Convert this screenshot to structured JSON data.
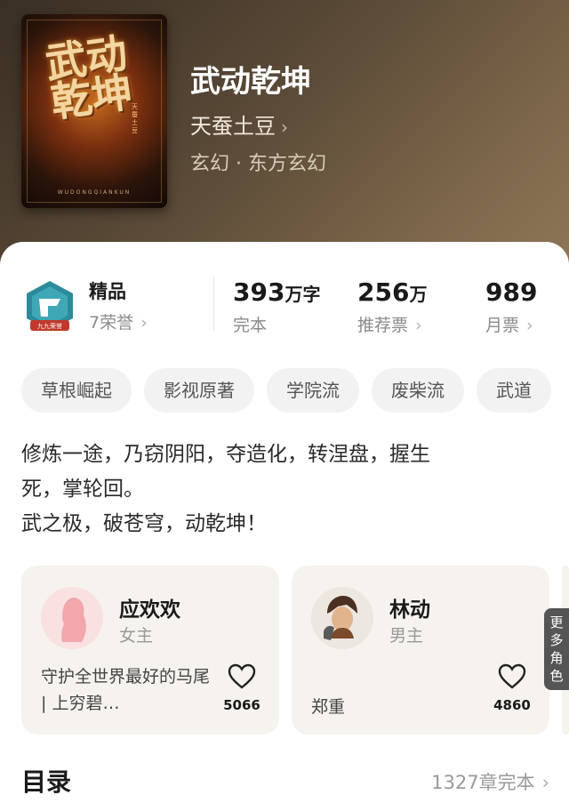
{
  "book": {
    "title": "武动乾坤",
    "author": "天蚕土豆",
    "genre": "玄幻 · 东方玄幻",
    "cover": {
      "title": "武动乾坤",
      "subtitle": "天蚕土豆",
      "footer": "WUDONGQIANKUN"
    }
  },
  "stats": {
    "premium": {
      "label": "精品",
      "honors": "7荣誉",
      "badge_text": "九九荣誉"
    },
    "words": {
      "value": "393",
      "unit": "万字",
      "sub": "完本"
    },
    "recommend": {
      "value": "256",
      "unit": "万",
      "sub": "推荐票"
    },
    "monthly": {
      "value": "989",
      "sub": "月票"
    }
  },
  "tags": [
    "草根崛起",
    "影视原著",
    "学院流",
    "废柴流",
    "武道"
  ],
  "description": [
    "修炼一途，乃窃阴阳，夺造化，转涅盘，握生",
    "死，掌轮回。",
    "武之极，破苍穹，动乾坤！"
  ],
  "characters": [
    {
      "name": "应欢欢",
      "role": "女主",
      "desc": "守护全世界最好的马尾 | 上穷碧…",
      "likes": "5066"
    },
    {
      "name": "林动",
      "role": "男主",
      "desc": "郑重",
      "likes": "4860"
    }
  ],
  "more_roles": [
    "更",
    "多",
    "角",
    "色"
  ],
  "toc": {
    "title": "目录",
    "meta": "1327章完本"
  },
  "icons": {
    "chevron": "chevron-right-icon",
    "heart": "heart-icon"
  },
  "colors": {
    "hero_bg": "#5a4a37",
    "tag_bg": "#f2f2f2",
    "card_bg": "#f6f3ee",
    "badge_teal": "#2c8a9a",
    "badge_red": "#c0392b"
  }
}
